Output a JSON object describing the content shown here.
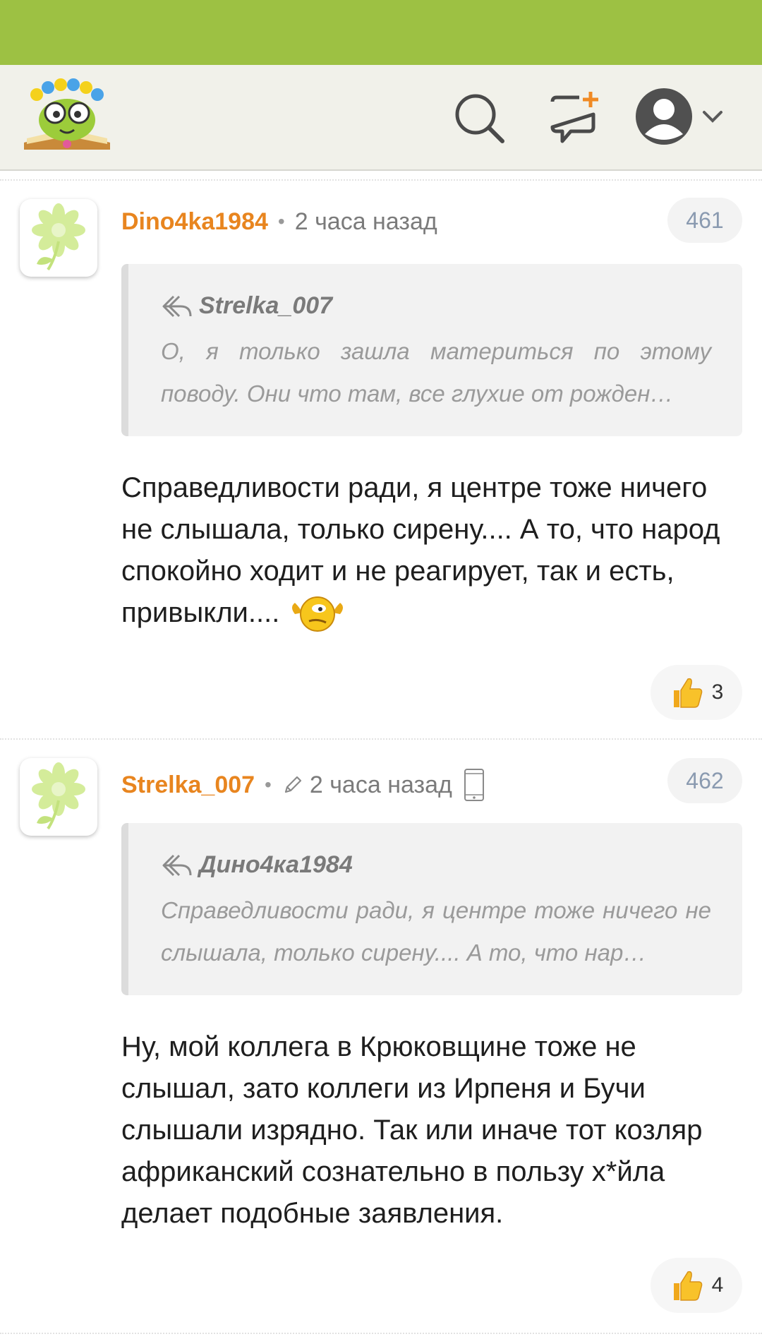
{
  "comments": [
    {
      "username": "Dino4ka1984",
      "separator": "•",
      "time": "2 часа назад",
      "number": "461",
      "quote_author": "Strelka_007",
      "quote_text": "О, я только зашла материться по этому поводу. Они что там, все глухие от рожден…",
      "text": "Справедливости ради, я центре тоже ничего не слышала, только сирену.... А то, что народ спокойно ходит и не реагирует, так и есть, привыкли....",
      "likes": "3",
      "icons": {
        "avatar": "daisy-avatar-icon",
        "reply": "reply-arrow-icon",
        "emoji": "smiley-icon",
        "like": "thumbs-up-icon"
      }
    },
    {
      "username": "Strelka_007",
      "separator": "•",
      "time": "2 часа назад",
      "number": "462",
      "quote_author": "Дино4ка1984",
      "quote_text": "Справедливости ради, я центре тоже ничего не слышала, только сирену.... А то, что нар…",
      "text": "Ну, мой коллега в Крюковщине тоже не слышал, зато коллеги из Ирпеня и Бучи слышали изрядно. Так или иначе тот козляр африканский сознательно в пользу х*йла делает подобные заявления.",
      "likes": "4",
      "icons": {
        "avatar": "daisy-avatar-icon",
        "edited": "pencil-icon",
        "device": "mobile-phone-icon",
        "reply": "reply-arrow-icon",
        "like": "thumbs-up-icon"
      }
    }
  ],
  "header_icons": [
    "site-logo",
    "search-icon",
    "new-message-icon",
    "user-avatar-icon",
    "chevron-down-icon"
  ],
  "colors": {
    "status_bar": "#9dc143",
    "header_bg": "#f1f1ea",
    "username": "#e8851f",
    "accent_plus": "#f08a24"
  }
}
